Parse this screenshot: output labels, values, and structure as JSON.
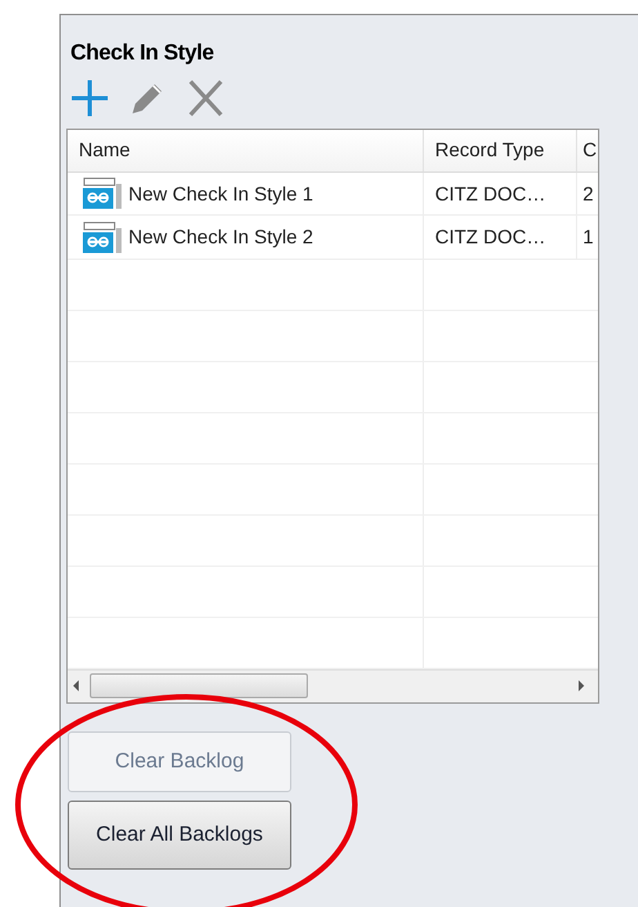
{
  "panel": {
    "title": "Check In Style"
  },
  "toolbar": [
    {
      "kind": "add"
    },
    {
      "kind": "edit"
    },
    {
      "kind": "delete"
    }
  ],
  "table": {
    "columns": [
      "Name",
      "Record Type",
      "C"
    ],
    "rows": [
      {
        "cells": [
          "New Check In Style 1",
          "CITZ DOC…",
          "2"
        ]
      },
      {
        "cells": [
          "New Check In Style 2",
          "CITZ DOC…",
          "1"
        ]
      }
    ]
  },
  "buttons": [
    {
      "label": "Clear Backlog",
      "disabled": true
    },
    {
      "label": "Clear All Backlogs",
      "disabled": false
    }
  ]
}
